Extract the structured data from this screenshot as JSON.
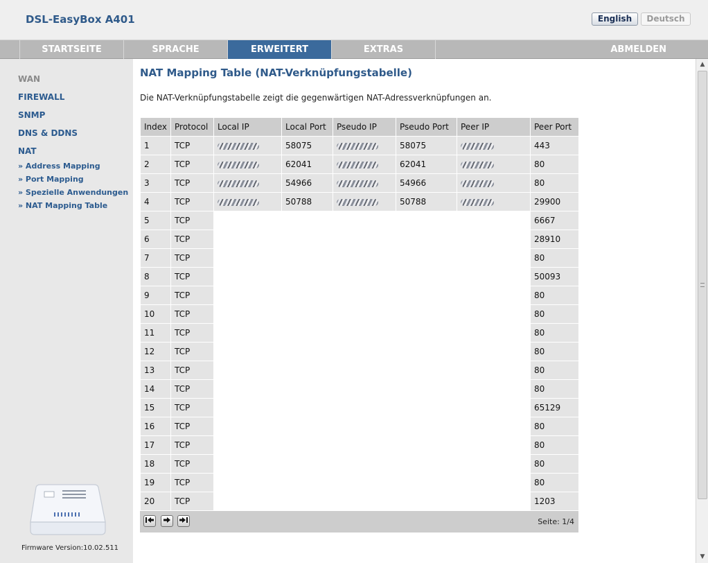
{
  "header": {
    "brand": "DSL-EasyBox A401",
    "lang_english": "English",
    "lang_deutsch": "Deutsch"
  },
  "nav": {
    "items": [
      "STARTSEITE",
      "SPRACHE",
      "ERWEITERT",
      "EXTRAS",
      "ABMELDEN"
    ],
    "active": "ERWEITERT"
  },
  "sidebar": {
    "items": [
      "WAN",
      "FIREWALL",
      "SNMP",
      "DNS & DDNS",
      "NAT"
    ],
    "subitems": [
      "» Address Mapping",
      "» Port Mapping",
      "» Spezielle Anwendungen",
      "» NAT Mapping Table"
    ],
    "firmware": "Firmware Version:10.02.511"
  },
  "main": {
    "title": "NAT Mapping Table (NAT-Verknüpfungstabelle)",
    "description": "Die NAT-Verknüpfungstabelle zeigt die gegenwärtigen NAT-Adressverknüpfungen an.",
    "columns": [
      "Index",
      "Protocol",
      "Local IP",
      "Local Port",
      "Pseudo IP",
      "Pseudo Port",
      "Peer IP",
      "Peer Port"
    ],
    "rows": [
      {
        "index": "1",
        "protocol": "TCP",
        "local_port": "58075",
        "pseudo_port": "58075",
        "peer_port": "443"
      },
      {
        "index": "2",
        "protocol": "TCP",
        "local_port": "62041",
        "pseudo_port": "62041",
        "peer_port": "80"
      },
      {
        "index": "3",
        "protocol": "TCP",
        "local_port": "54966",
        "pseudo_port": "54966",
        "peer_port": "80"
      },
      {
        "index": "4",
        "protocol": "TCP",
        "local_port": "50788",
        "pseudo_port": "50788",
        "peer_port": "29900"
      },
      {
        "index": "5",
        "protocol": "TCP",
        "peer_port": "6667"
      },
      {
        "index": "6",
        "protocol": "TCP",
        "peer_port": "28910"
      },
      {
        "index": "7",
        "protocol": "TCP",
        "peer_port": "80"
      },
      {
        "index": "8",
        "protocol": "TCP",
        "peer_port": "50093"
      },
      {
        "index": "9",
        "protocol": "TCP",
        "peer_port": "80"
      },
      {
        "index": "10",
        "protocol": "TCP",
        "peer_port": "80"
      },
      {
        "index": "11",
        "protocol": "TCP",
        "peer_port": "80"
      },
      {
        "index": "12",
        "protocol": "TCP",
        "peer_port": "80"
      },
      {
        "index": "13",
        "protocol": "TCP",
        "peer_port": "80"
      },
      {
        "index": "14",
        "protocol": "TCP",
        "peer_port": "80"
      },
      {
        "index": "15",
        "protocol": "TCP",
        "peer_port": "65129"
      },
      {
        "index": "16",
        "protocol": "TCP",
        "peer_port": "80"
      },
      {
        "index": "17",
        "protocol": "TCP",
        "peer_port": "80"
      },
      {
        "index": "18",
        "protocol": "TCP",
        "peer_port": "80"
      },
      {
        "index": "19",
        "protocol": "TCP",
        "peer_port": "80"
      },
      {
        "index": "20",
        "protocol": "TCP",
        "peer_port": "1203"
      }
    ],
    "pager": "Seite: 1/4"
  },
  "colors": {
    "accent": "#3b6a9c",
    "brand_text": "#2f5a8a",
    "nav_bg": "#b8b8b8"
  }
}
